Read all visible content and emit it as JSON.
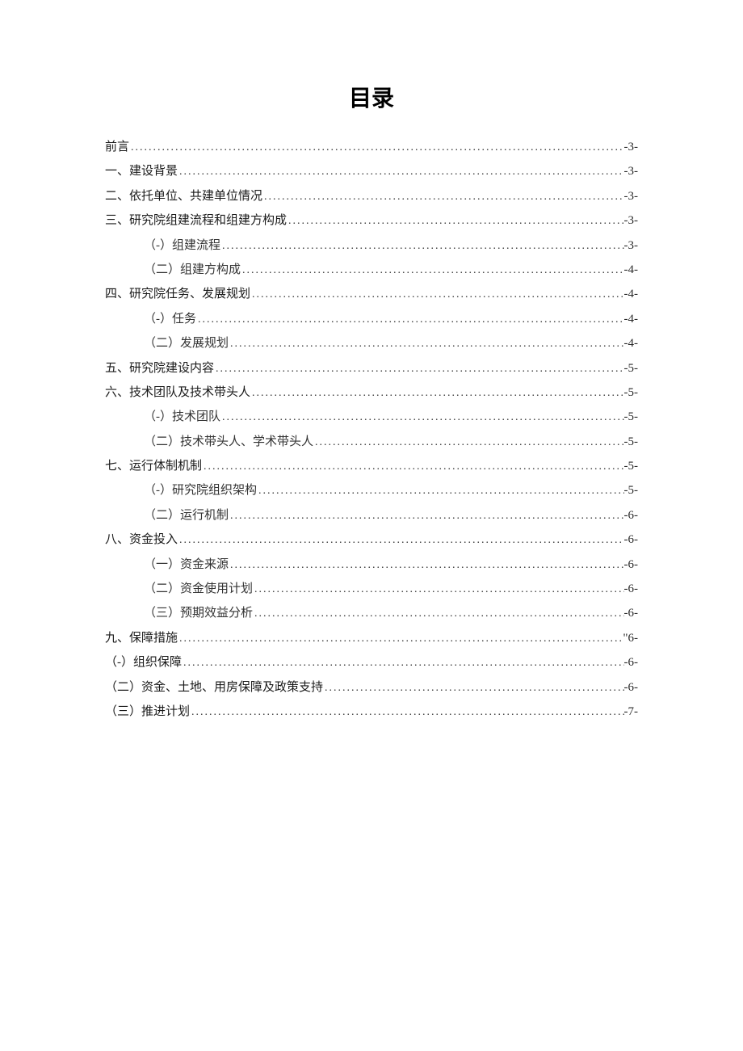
{
  "title": "目录",
  "toc": [
    {
      "label": "前言",
      "page": "-3-",
      "indent": false
    },
    {
      "label": "一、建设背景",
      "page": "-3-",
      "indent": false
    },
    {
      "label": "二、依托单位、共建单位情况",
      "page": "-3-",
      "indent": false
    },
    {
      "label": "三、研究院组建流程和组建方构成",
      "page": "-3-",
      "indent": false
    },
    {
      "label": "（-）组建流程",
      "page": "-3-",
      "indent": true
    },
    {
      "label": "（二）组建方构成",
      "page": "-4-",
      "indent": true
    },
    {
      "label": "四、研究院任务、发展规划",
      "page": "-4-",
      "indent": false
    },
    {
      "label": "（-）任务",
      "page": "-4-",
      "indent": true
    },
    {
      "label": "（二）发展规划",
      "page": "-4-",
      "indent": true
    },
    {
      "label": "五、研究院建设内容",
      "page": "-5-",
      "indent": false
    },
    {
      "label": "六、技术团队及技术带头人",
      "page": "-5-",
      "indent": false
    },
    {
      "label": "（-）技术团队",
      "page": "-5-",
      "indent": true
    },
    {
      "label": "（二）技术带头人、学术带头人",
      "page": "-5-",
      "indent": true
    },
    {
      "label": "七、运行体制机制",
      "page": "-5-",
      "indent": false
    },
    {
      "label": "（-）研究院组织架构",
      "page": "-5-",
      "indent": true
    },
    {
      "label": "（二）运行机制",
      "page": "-6-",
      "indent": true
    },
    {
      "label": "八、资金投入",
      "page": "-6-",
      "indent": false
    },
    {
      "label": "（一）资金来源",
      "page": "-6-",
      "indent": true
    },
    {
      "label": "（二）资金使用计划",
      "page": "-6-",
      "indent": true
    },
    {
      "label": "（三）预期效益分析",
      "page": "-6-",
      "indent": true
    },
    {
      "label": "九、保障措施",
      "page": "\"6-",
      "indent": false
    },
    {
      "label": "（-）组织保障",
      "page": "-6-",
      "indent": false
    },
    {
      "label": "（二）资金、土地、用房保障及政策支持",
      "page": "-6-",
      "indent": false
    },
    {
      "label": "（三）推进计划",
      "page": "-7-",
      "indent": false
    }
  ]
}
